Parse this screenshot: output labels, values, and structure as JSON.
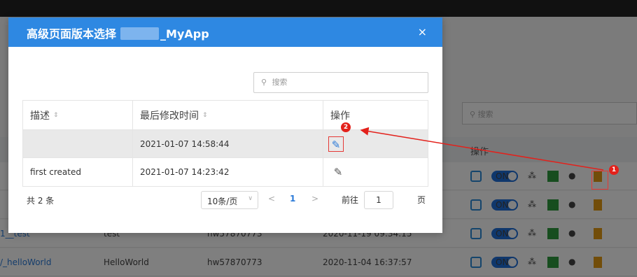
{
  "background": {
    "search_placeholder": "搜索",
    "op_header": "操作",
    "rows": [
      {
        "name": "",
        "desc": "",
        "owner": "",
        "time": ""
      },
      {
        "name": "",
        "desc": "",
        "owner": "",
        "time": ""
      },
      {
        "name": "1__test",
        "desc": "test",
        "owner": "hw57870773",
        "time": "2020-11-19 09:34:15"
      },
      {
        "name": "/_helloWorld",
        "desc": "HelloWorld",
        "owner": "hw57870773",
        "time": "2020-11-04 16:37:57"
      }
    ],
    "toggle_label": "ON"
  },
  "dialog": {
    "title_prefix": "高级页面版本选择",
    "title_suffix": "_MyApp",
    "close_glyph": "×",
    "search_placeholder": "搜索",
    "columns": {
      "desc": "描述",
      "time": "最后修改时间",
      "op": "操作"
    },
    "rows": [
      {
        "desc": "",
        "time": "2021-01-07 14:58:44"
      },
      {
        "desc": "first created",
        "time": "2021-01-07 14:23:42"
      }
    ],
    "pagination": {
      "total": "共 2 条",
      "page_size": "10条/页",
      "current_page": "1",
      "goto_label": "前往",
      "goto_value": "1",
      "page_word": "页"
    }
  },
  "annotations": {
    "badge1": "1",
    "badge2": "2",
    "color": "#e3211b"
  },
  "colors": {
    "header_blue": "#2e88e2",
    "accent_blue": "#2a7ad8",
    "toggle_blue": "#1e6fd9",
    "green": "#2e9b3e",
    "orange": "#e59a12",
    "red": "#e53935"
  }
}
